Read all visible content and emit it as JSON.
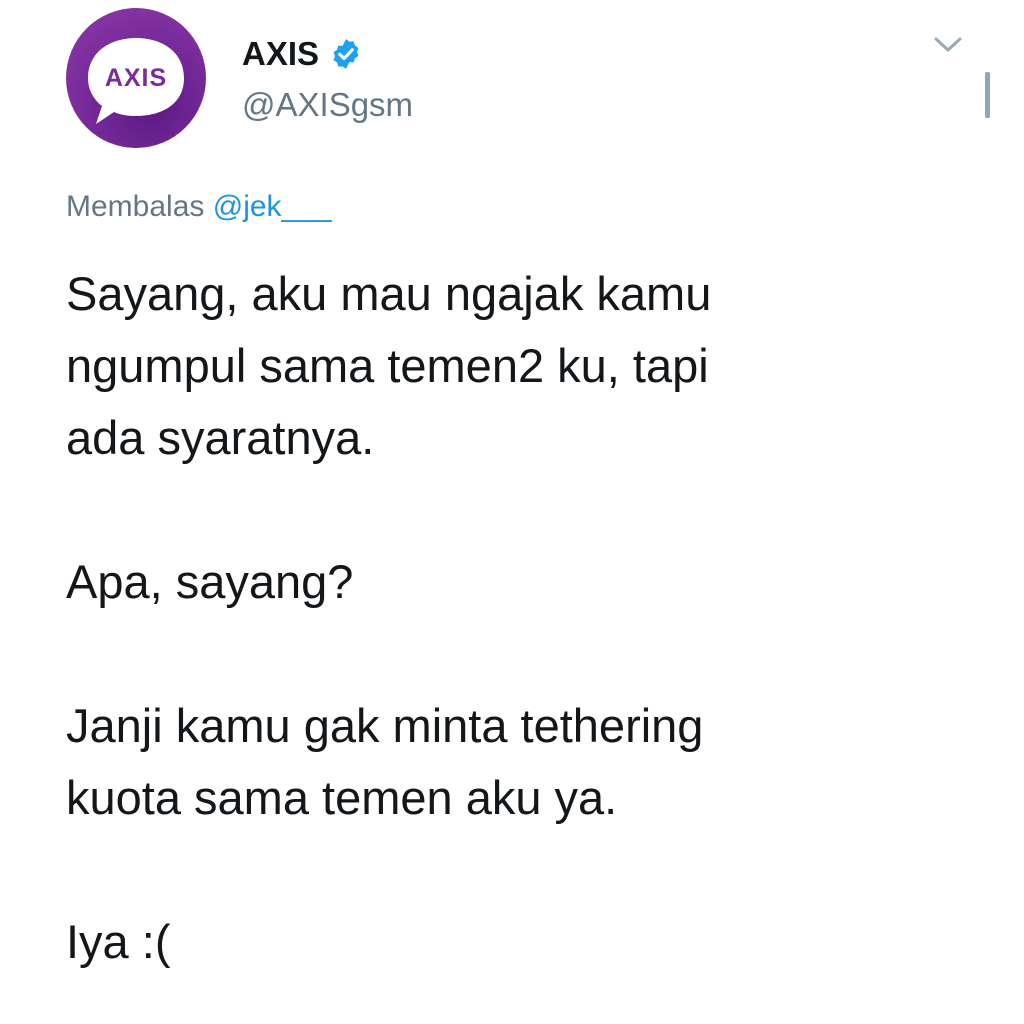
{
  "tweet": {
    "author": {
      "avatar_text": "AXIS",
      "display_name": "AXIS",
      "handle": "@AXISgsm",
      "verified_icon": "verified-badge-icon"
    },
    "menu_icon": "chevron-down-icon",
    "reply_context": {
      "prefix": "Membalas",
      "mention": "@jek___"
    },
    "paragraphs": [
      "Sayang, aku mau ngajak kamu\nngumpul sama temen2 ku, tapi\nada syaratnya.",
      "Apa, sayang?",
      "Janji kamu gak minta tethering\nkuota sama temen aku ya.",
      "Iya :("
    ]
  },
  "colors": {
    "brand_purple": "#7a2c9c",
    "verified_blue": "#1da1f2",
    "mention_blue": "#1b95e0",
    "secondary_text": "#657786"
  }
}
